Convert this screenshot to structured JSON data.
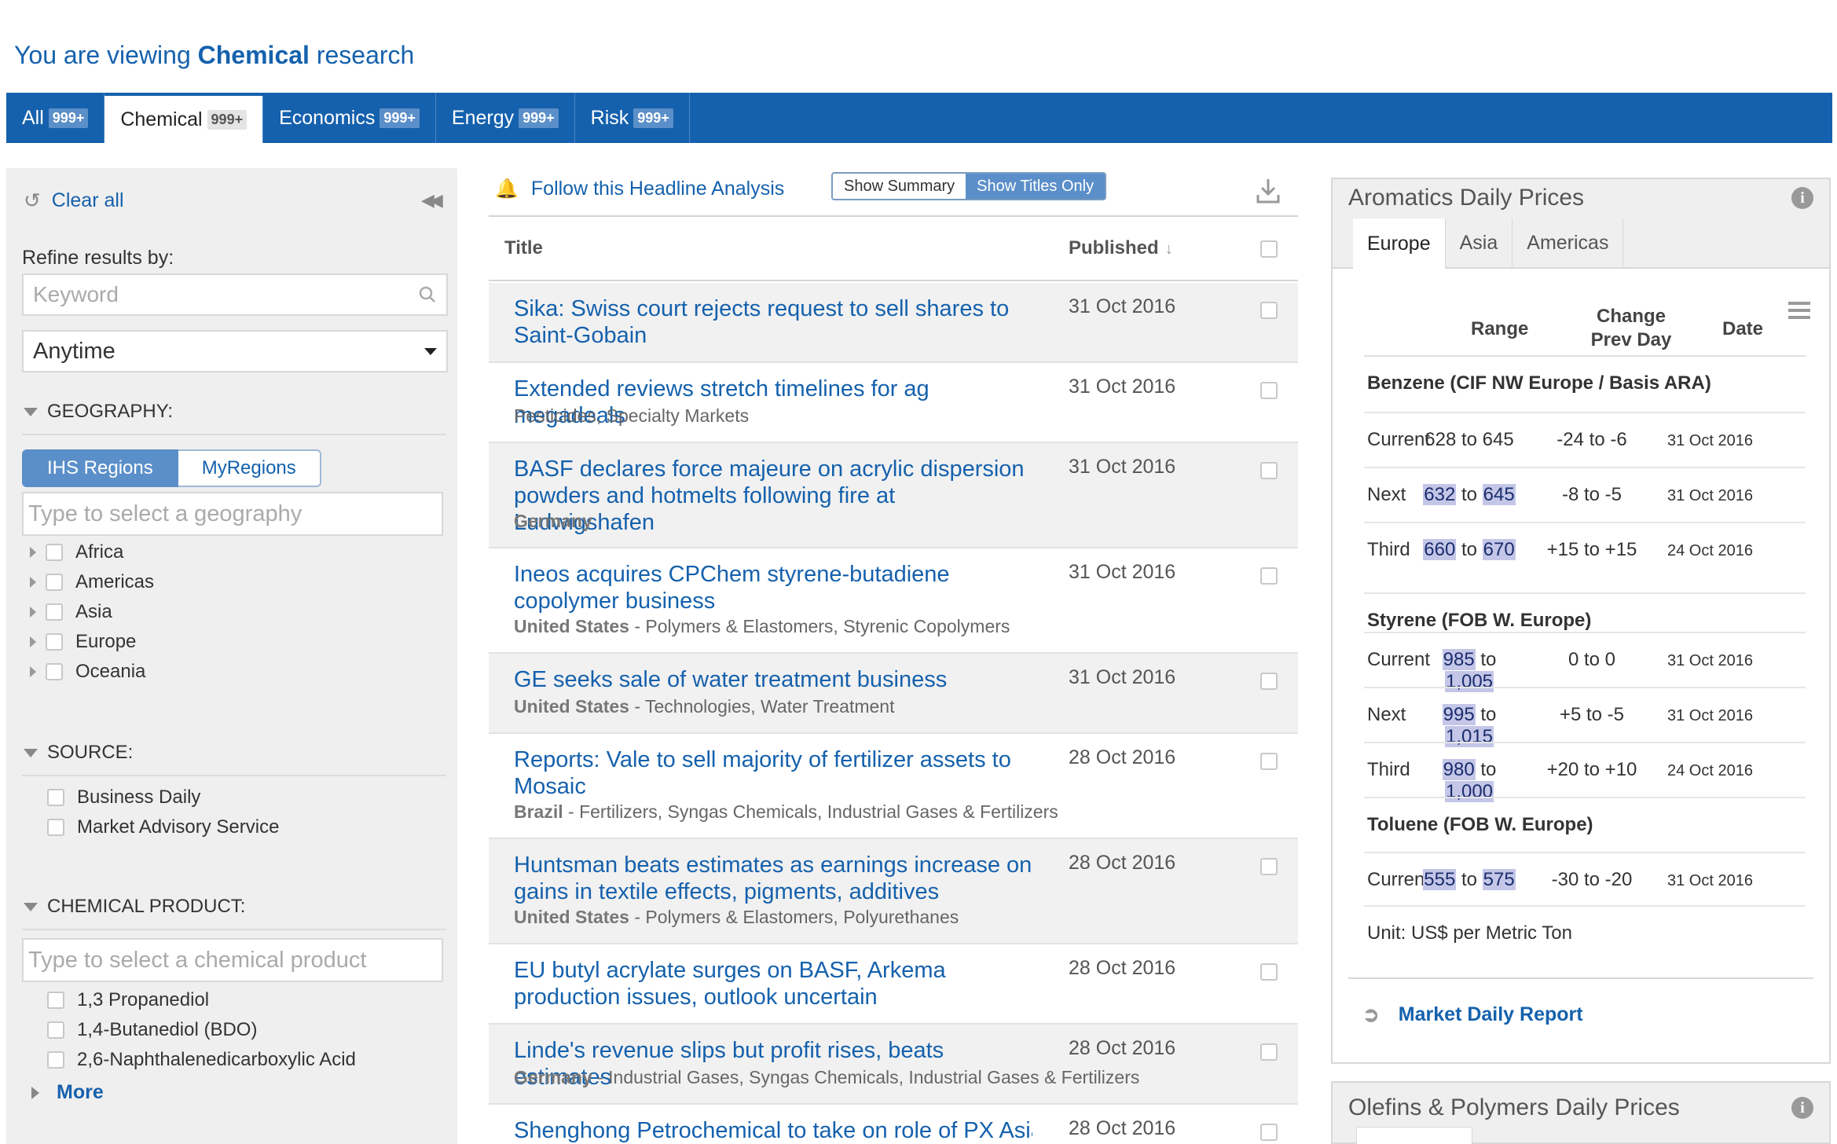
{
  "page_title": {
    "prefix": "You are viewing ",
    "subject": "Chemical",
    "suffix": " research"
  },
  "tabs": [
    {
      "label": "All",
      "badge": "999+"
    },
    {
      "label": "Chemical",
      "badge": "999+"
    },
    {
      "label": "Economics",
      "badge": "999+"
    },
    {
      "label": "Energy",
      "badge": "999+"
    },
    {
      "label": "Risk",
      "badge": "999+"
    }
  ],
  "filters": {
    "clear_all": "Clear all",
    "refine_label": "Refine results by:",
    "keyword_placeholder": "Keyword",
    "time_selected": "Anytime",
    "geography_title": "GEOGRAPHY:",
    "region_toggle": [
      "IHS Regions",
      "MyRegions"
    ],
    "geography_placeholder": "Type to select a geography",
    "geographies": [
      "Africa",
      "Americas",
      "Asia",
      "Europe",
      "Oceania"
    ],
    "source_title": "SOURCE:",
    "sources": [
      "Business Daily",
      "Market Advisory Service"
    ],
    "product_title": "CHEMICAL PRODUCT:",
    "product_placeholder": "Type to select a chemical product",
    "products": [
      "1,3 Propanediol",
      "1,4-Butanediol (BDO)",
      "2,6-Naphthalenedicarboxylic Acid"
    ],
    "more_label": "More"
  },
  "list": {
    "follow_label": "Follow this Headline Analysis",
    "toggle": {
      "summary": "Show Summary",
      "titles": "Show Titles Only"
    },
    "col_title": "Title",
    "col_published": "Published",
    "articles": [
      {
        "title": "Sika: Swiss court rejects request to sell shares to Saint-Gobain",
        "region": "",
        "tags": "",
        "date": "31 Oct 2016"
      },
      {
        "title": "Extended reviews stretch timelines for ag megadeals",
        "region": "",
        "tags": "Pesticides, Specialty Markets",
        "date": "31 Oct 2016"
      },
      {
        "title": "BASF declares force majeure on acrylic dispersion powders and hotmelts following fire at Ludwigshafen",
        "region": "Germany",
        "tags": "",
        "date": "31 Oct 2016"
      },
      {
        "title": "Ineos acquires CPChem styrene-butadiene copolymer business",
        "region": "United States",
        "tags": " - Polymers & Elastomers, Styrenic Copolymers",
        "date": "31 Oct 2016"
      },
      {
        "title": "GE seeks sale of water treatment business",
        "region": "United States",
        "tags": " - Technologies, Water Treatment",
        "date": "31 Oct 2016"
      },
      {
        "title": "Reports: Vale to sell majority of fertilizer assets to Mosaic",
        "region": "Brazil",
        "tags": " - Fertilizers, Syngas Chemicals, Industrial Gases & Fertilizers",
        "date": "28 Oct 2016"
      },
      {
        "title": "Huntsman beats estimates as earnings increase on gains in textile effects, pigments, additives",
        "region": "United States",
        "tags": " - Polymers & Elastomers, Polyurethanes",
        "date": "28 Oct 2016"
      },
      {
        "title": "EU butyl acrylate surges on BASF, Arkema production issues, outlook uncertain",
        "region": "",
        "tags": "",
        "date": "28 Oct 2016"
      },
      {
        "title": "Linde's revenue slips but profit rises, beats estimates",
        "region": "Germany",
        "tags": " - Industrial Gases, Syngas Chemicals, Industrial Gases & Fertilizers",
        "date": "28 Oct 2016"
      },
      {
        "title": "Shenghong Petrochemical to take on role of PX Asia",
        "region": "",
        "tags": "",
        "date": "28 Oct 2016"
      }
    ]
  },
  "prices": {
    "title": "Aromatics Daily Prices",
    "tabs": [
      "Europe",
      "Asia",
      "Americas"
    ],
    "col_range": "Range",
    "col_change": "Change\nPrev Day",
    "col_change_l1": "Change",
    "col_change_l2": "Prev Day",
    "col_date": "Date",
    "to_word": "to",
    "products": [
      {
        "name": "Benzene (CIF NW Europe / Basis ARA)",
        "rows": [
          {
            "label": "Current",
            "low": "628",
            "high": "645",
            "change": "-24 to -6",
            "date": "31 Oct 2016"
          },
          {
            "label": "Next",
            "low": "632",
            "high": "645",
            "change": "-8 to -5",
            "date": "31 Oct 2016"
          },
          {
            "label": "Third",
            "low": "660",
            "high": "670",
            "change": "+15 to +15",
            "date": "24 Oct 2016"
          }
        ]
      },
      {
        "name": "Styrene (FOB W. Europe)",
        "rows": [
          {
            "label": "Current",
            "low": "985",
            "high": "1,005",
            "change": "0 to 0",
            "date": "31 Oct 2016"
          },
          {
            "label": "Next",
            "low": "995",
            "high": "1,015",
            "change": "+5 to -5",
            "date": "31 Oct 2016"
          },
          {
            "label": "Third",
            "low": "980",
            "high": "1,000",
            "change": "+20 to +10",
            "date": "24 Oct 2016"
          }
        ]
      },
      {
        "name": "Toluene (FOB W. Europe)",
        "rows": [
          {
            "label": "Current",
            "low": "555",
            "high": "575",
            "change": "-30 to -20",
            "date": "31 Oct 2016"
          }
        ]
      }
    ],
    "unit": "Unit: US$ per Metric Ton",
    "report_link": "Market Daily Report"
  },
  "olefins_widget": {
    "title": "Olefins & Polymers Daily Prices"
  },
  "colors": {
    "brand_blue": "#1561ad",
    "badge_blue": "#5b8fc9",
    "panel_gray": "#efefef",
    "highlight": "#c4c6e8"
  }
}
